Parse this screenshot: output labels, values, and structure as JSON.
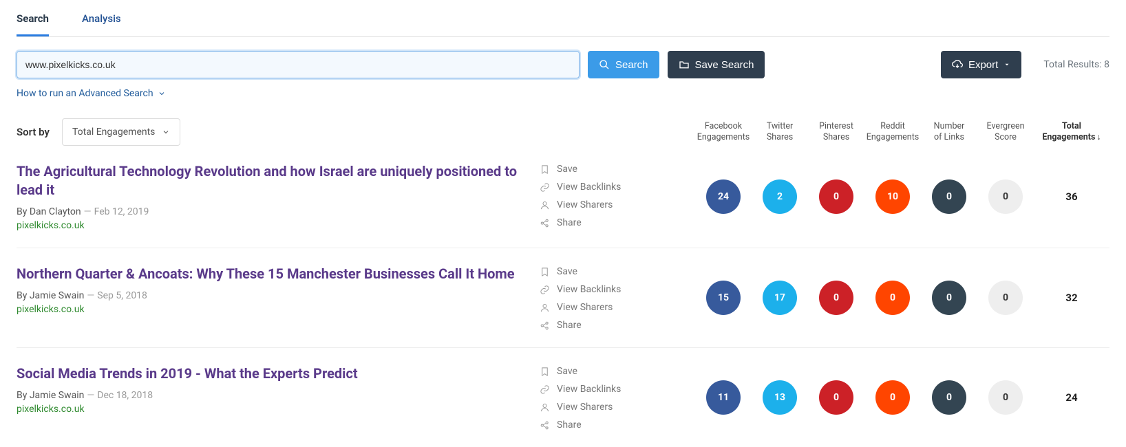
{
  "tabs": {
    "search": "Search",
    "analysis": "Analysis"
  },
  "search": {
    "value": "www.pixelkicks.co.uk",
    "button": "Search",
    "save": "Save Search",
    "export": "Export",
    "total_label": "Total Results: ",
    "total_value": "8",
    "advanced": "How to run an Advanced Search"
  },
  "sort": {
    "label": "Sort by",
    "value": "Total Engagements"
  },
  "columns": {
    "fb1": "Facebook",
    "fb2": "Engagements",
    "tw1": "Twitter",
    "tw2": "Shares",
    "pin1": "Pinterest",
    "pin2": "Shares",
    "rd1": "Reddit",
    "rd2": "Engagements",
    "ln1": "Number",
    "ln2": "of Links",
    "ev1": "Evergreen",
    "ev2": "Score",
    "tot1": "Total",
    "tot2": "Engagements"
  },
  "actions": {
    "save": "Save",
    "backlinks": "View Backlinks",
    "sharers": "View Sharers",
    "share": "Share"
  },
  "results": [
    {
      "title": "The Agricultural Technology Revolution and how Israel are uniquely positioned to lead it",
      "author": "Dan Clayton",
      "date": "Feb 12, 2019",
      "domain": "pixelkicks.co.uk",
      "fb": "24",
      "tw": "2",
      "pin": "0",
      "rd": "10",
      "links": "0",
      "ever": "0",
      "total": "36"
    },
    {
      "title": "Northern Quarter & Ancoats: Why These 15 Manchester Businesses Call It Home",
      "author": "Jamie Swain",
      "date": "Sep 5, 2018",
      "domain": "pixelkicks.co.uk",
      "fb": "15",
      "tw": "17",
      "pin": "0",
      "rd": "0",
      "links": "0",
      "ever": "0",
      "total": "32"
    },
    {
      "title": "Social Media Trends in 2019 - What the Experts Predict",
      "author": "Jamie Swain",
      "date": "Dec 18, 2018",
      "domain": "pixelkicks.co.uk",
      "fb": "11",
      "tw": "13",
      "pin": "0",
      "rd": "0",
      "links": "0",
      "ever": "0",
      "total": "24"
    }
  ]
}
